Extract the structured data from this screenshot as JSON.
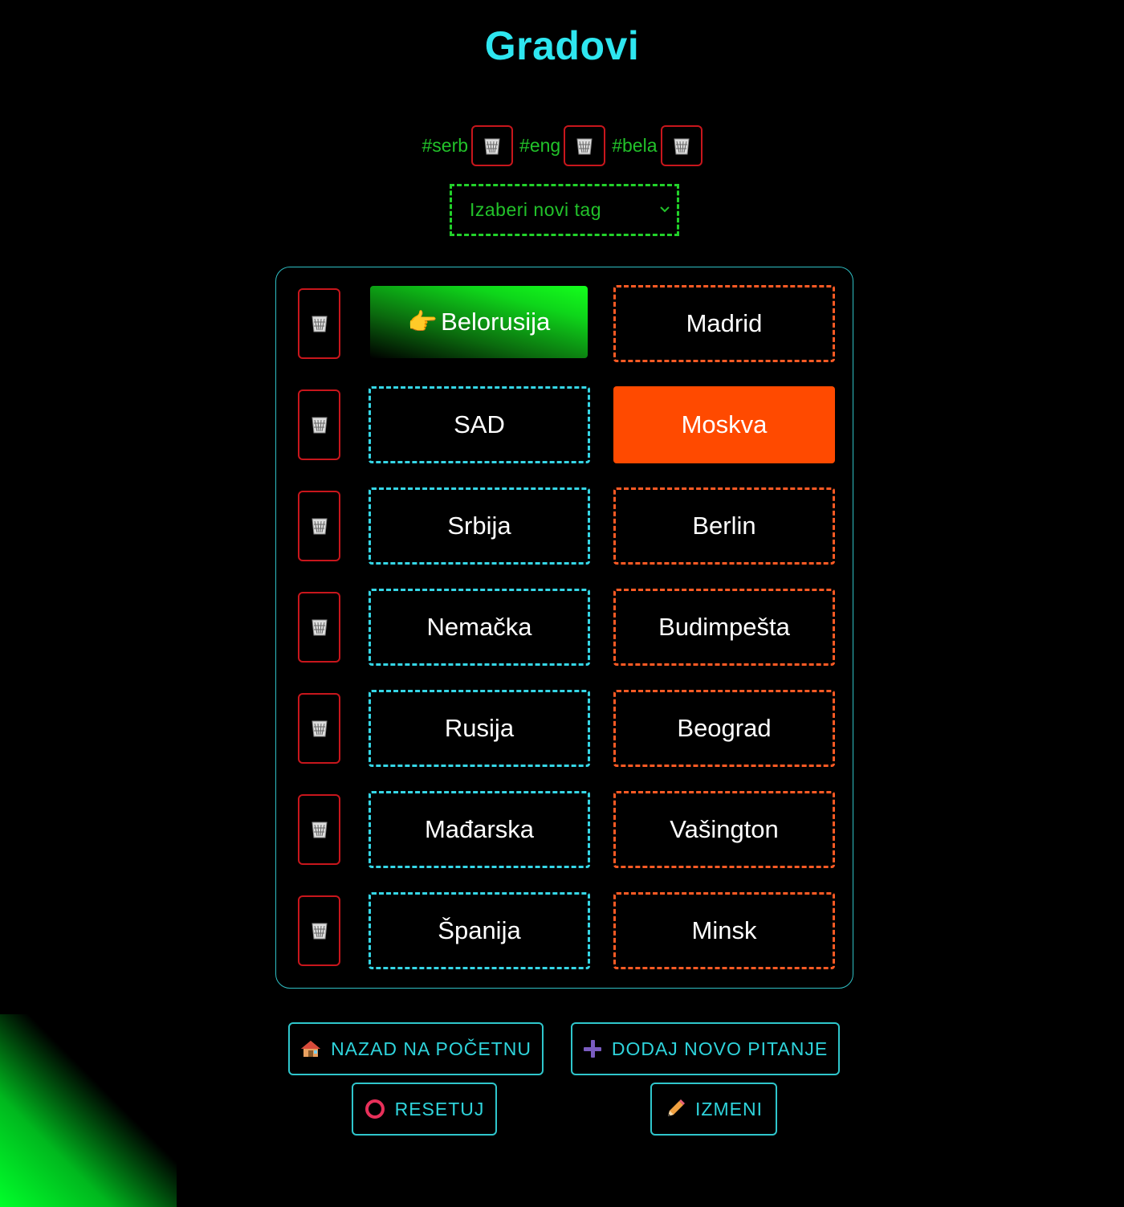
{
  "title": "Gradovi",
  "tags": [
    {
      "label": "#serb"
    },
    {
      "label": "#eng"
    },
    {
      "label": "#bela"
    }
  ],
  "tag_select": {
    "placeholder": "Izaberi novi tag"
  },
  "rows": [
    {
      "left": "Belorusija",
      "right": "Madrid"
    },
    {
      "left": "SAD",
      "right": "Moskva"
    },
    {
      "left": "Srbija",
      "right": "Berlin"
    },
    {
      "left": "Nemačka",
      "right": "Budimpešta"
    },
    {
      "left": "Rusija",
      "right": "Beograd"
    },
    {
      "left": "Mađarska",
      "right": "Vašington"
    },
    {
      "left": "Španija",
      "right": "Minsk"
    }
  ],
  "selected_left_icon": "👉",
  "buttons": {
    "home": "NAZAD NA POČETNU",
    "add": "DODAJ NOVO PITANJE",
    "reset": "RESETUJ",
    "edit": "IZMENI"
  },
  "colors": {
    "title": "#2ee6f0",
    "tag_text": "#22c22a",
    "trash_border": "#c8161c",
    "left_border": "#35d6e6",
    "right_border": "#ff5a24",
    "selected_right": "#ff4a00",
    "selected_left": "#0ed61a"
  }
}
